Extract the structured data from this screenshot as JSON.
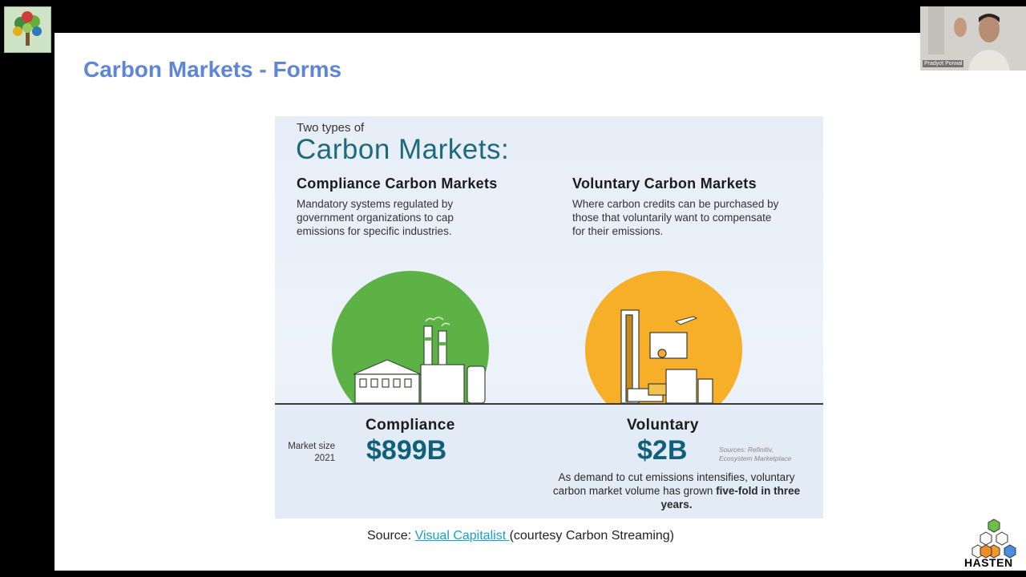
{
  "slide": {
    "title": "Carbon Markets - Forms"
  },
  "infographic": {
    "intro_small": "Two types of",
    "intro_big": "Carbon Markets:",
    "compliance": {
      "heading": "Compliance Carbon Markets",
      "description": "Mandatory systems regulated by government organizations to cap emissions for specific industries.",
      "label": "Compliance",
      "value": "$899B"
    },
    "voluntary": {
      "heading": "Voluntary Carbon Markets",
      "description": "Where carbon credits can be purchased by those that voluntarily want to compensate for their emissions.",
      "label": "Voluntary",
      "value": "$2B"
    },
    "market_size_label": "Market size",
    "market_size_year": "2021",
    "sources_line1": "Sources: Refinitiv,",
    "sources_line2": "Ecosystem Marketplace",
    "growth_text": "As demand to cut emissions intensifies, voluntary carbon market volume has grown",
    "growth_bold": "five-fold in three years."
  },
  "source": {
    "prefix": "Source: ",
    "link_text": "Visual Capitalist ",
    "suffix": "(courtesy Carbon Streaming)"
  },
  "brand": {
    "name": "HASTEN"
  },
  "video": {
    "participant_name": "Pradyot Porwal"
  },
  "colors": {
    "title": "#5f86d6",
    "compliance_circle": "#5cb244",
    "voluntary_circle": "#f7ae28",
    "value_text": "#11607a",
    "link": "#1aa0c8"
  }
}
